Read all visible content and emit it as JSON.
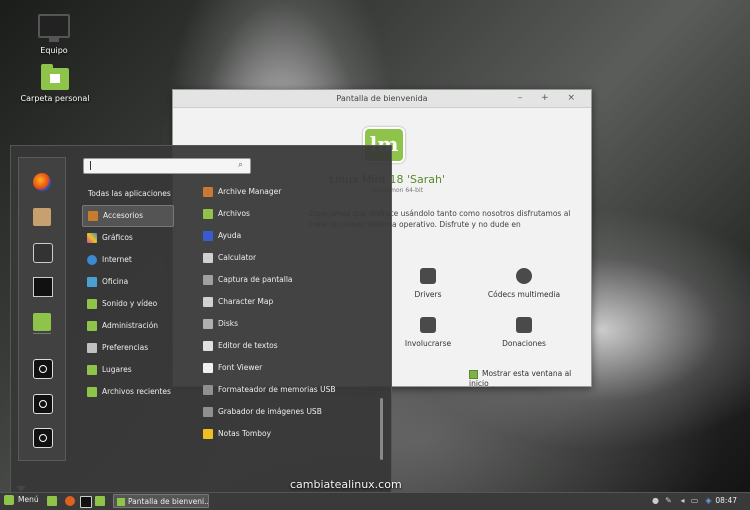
{
  "desktop": {
    "icons": [
      {
        "label": "Equipo",
        "icon": "computer-icon"
      },
      {
        "label": "Carpeta personal",
        "icon": "home-folder-icon"
      }
    ]
  },
  "welcome": {
    "title": "Pantalla de bienvenida",
    "controls": "– + ×",
    "heading": "Linux Mint 18 'Sarah'",
    "subheading": "Cinnamon 64-bit",
    "text": "Esperamos que disfrute usándolo tanto como nosotros disfrutamos al crear su nuevo sistema operativo. Disfrute y no dude en",
    "buttons": [
      {
        "label": "Drivers"
      },
      {
        "label": "Códecs multimedia"
      },
      {
        "label": "Involucrarse"
      },
      {
        "label": "Donaciones"
      }
    ],
    "checkbox_label": "Mostrar esta ventana al inicio"
  },
  "menu": {
    "search_placeholder": "",
    "categories": [
      {
        "label": "Todas las aplicaciones",
        "color": ""
      },
      {
        "label": "Accesorios",
        "color": "#c87a30"
      },
      {
        "label": "Gráficos",
        "color": "#d04aa0"
      },
      {
        "label": "Internet",
        "color": "#3a8ad0"
      },
      {
        "label": "Oficina",
        "color": "#4aa0d0"
      },
      {
        "label": "Sonido y vídeo",
        "color": "#8ec44a"
      },
      {
        "label": "Administración",
        "color": "#8ec44a"
      },
      {
        "label": "Preferencias",
        "color": "#c0c0c0"
      },
      {
        "label": "Lugares",
        "color": "#8ec44a"
      },
      {
        "label": "Archivos recientes",
        "color": "#8ec44a"
      }
    ],
    "apps": [
      {
        "label": "Archive Manager",
        "color": "#c87a30"
      },
      {
        "label": "Archivos",
        "color": "#8ec44a"
      },
      {
        "label": "Ayuda",
        "color": "#3a5ad0"
      },
      {
        "label": "Calculator",
        "color": "#d0d0d0"
      },
      {
        "label": "Captura de pantalla",
        "color": "#a0a0a0"
      },
      {
        "label": "Character Map",
        "color": "#d0d0d0"
      },
      {
        "label": "Disks",
        "color": "#b0b0b0"
      },
      {
        "label": "Editor de textos",
        "color": "#e0e0e0"
      },
      {
        "label": "Font Viewer",
        "color": "#f0f0f0"
      },
      {
        "label": "Formateador de memorias USB",
        "color": "#909090"
      },
      {
        "label": "Grabador de imágenes USB",
        "color": "#909090"
      },
      {
        "label": "Notas Tomboy",
        "color": "#f0c020"
      }
    ]
  },
  "taskbar": {
    "menu_label": "Menú",
    "window_label": "Pantalla de bienveni...",
    "clock": "08:47"
  },
  "watermark": "cambiatealinux.com"
}
